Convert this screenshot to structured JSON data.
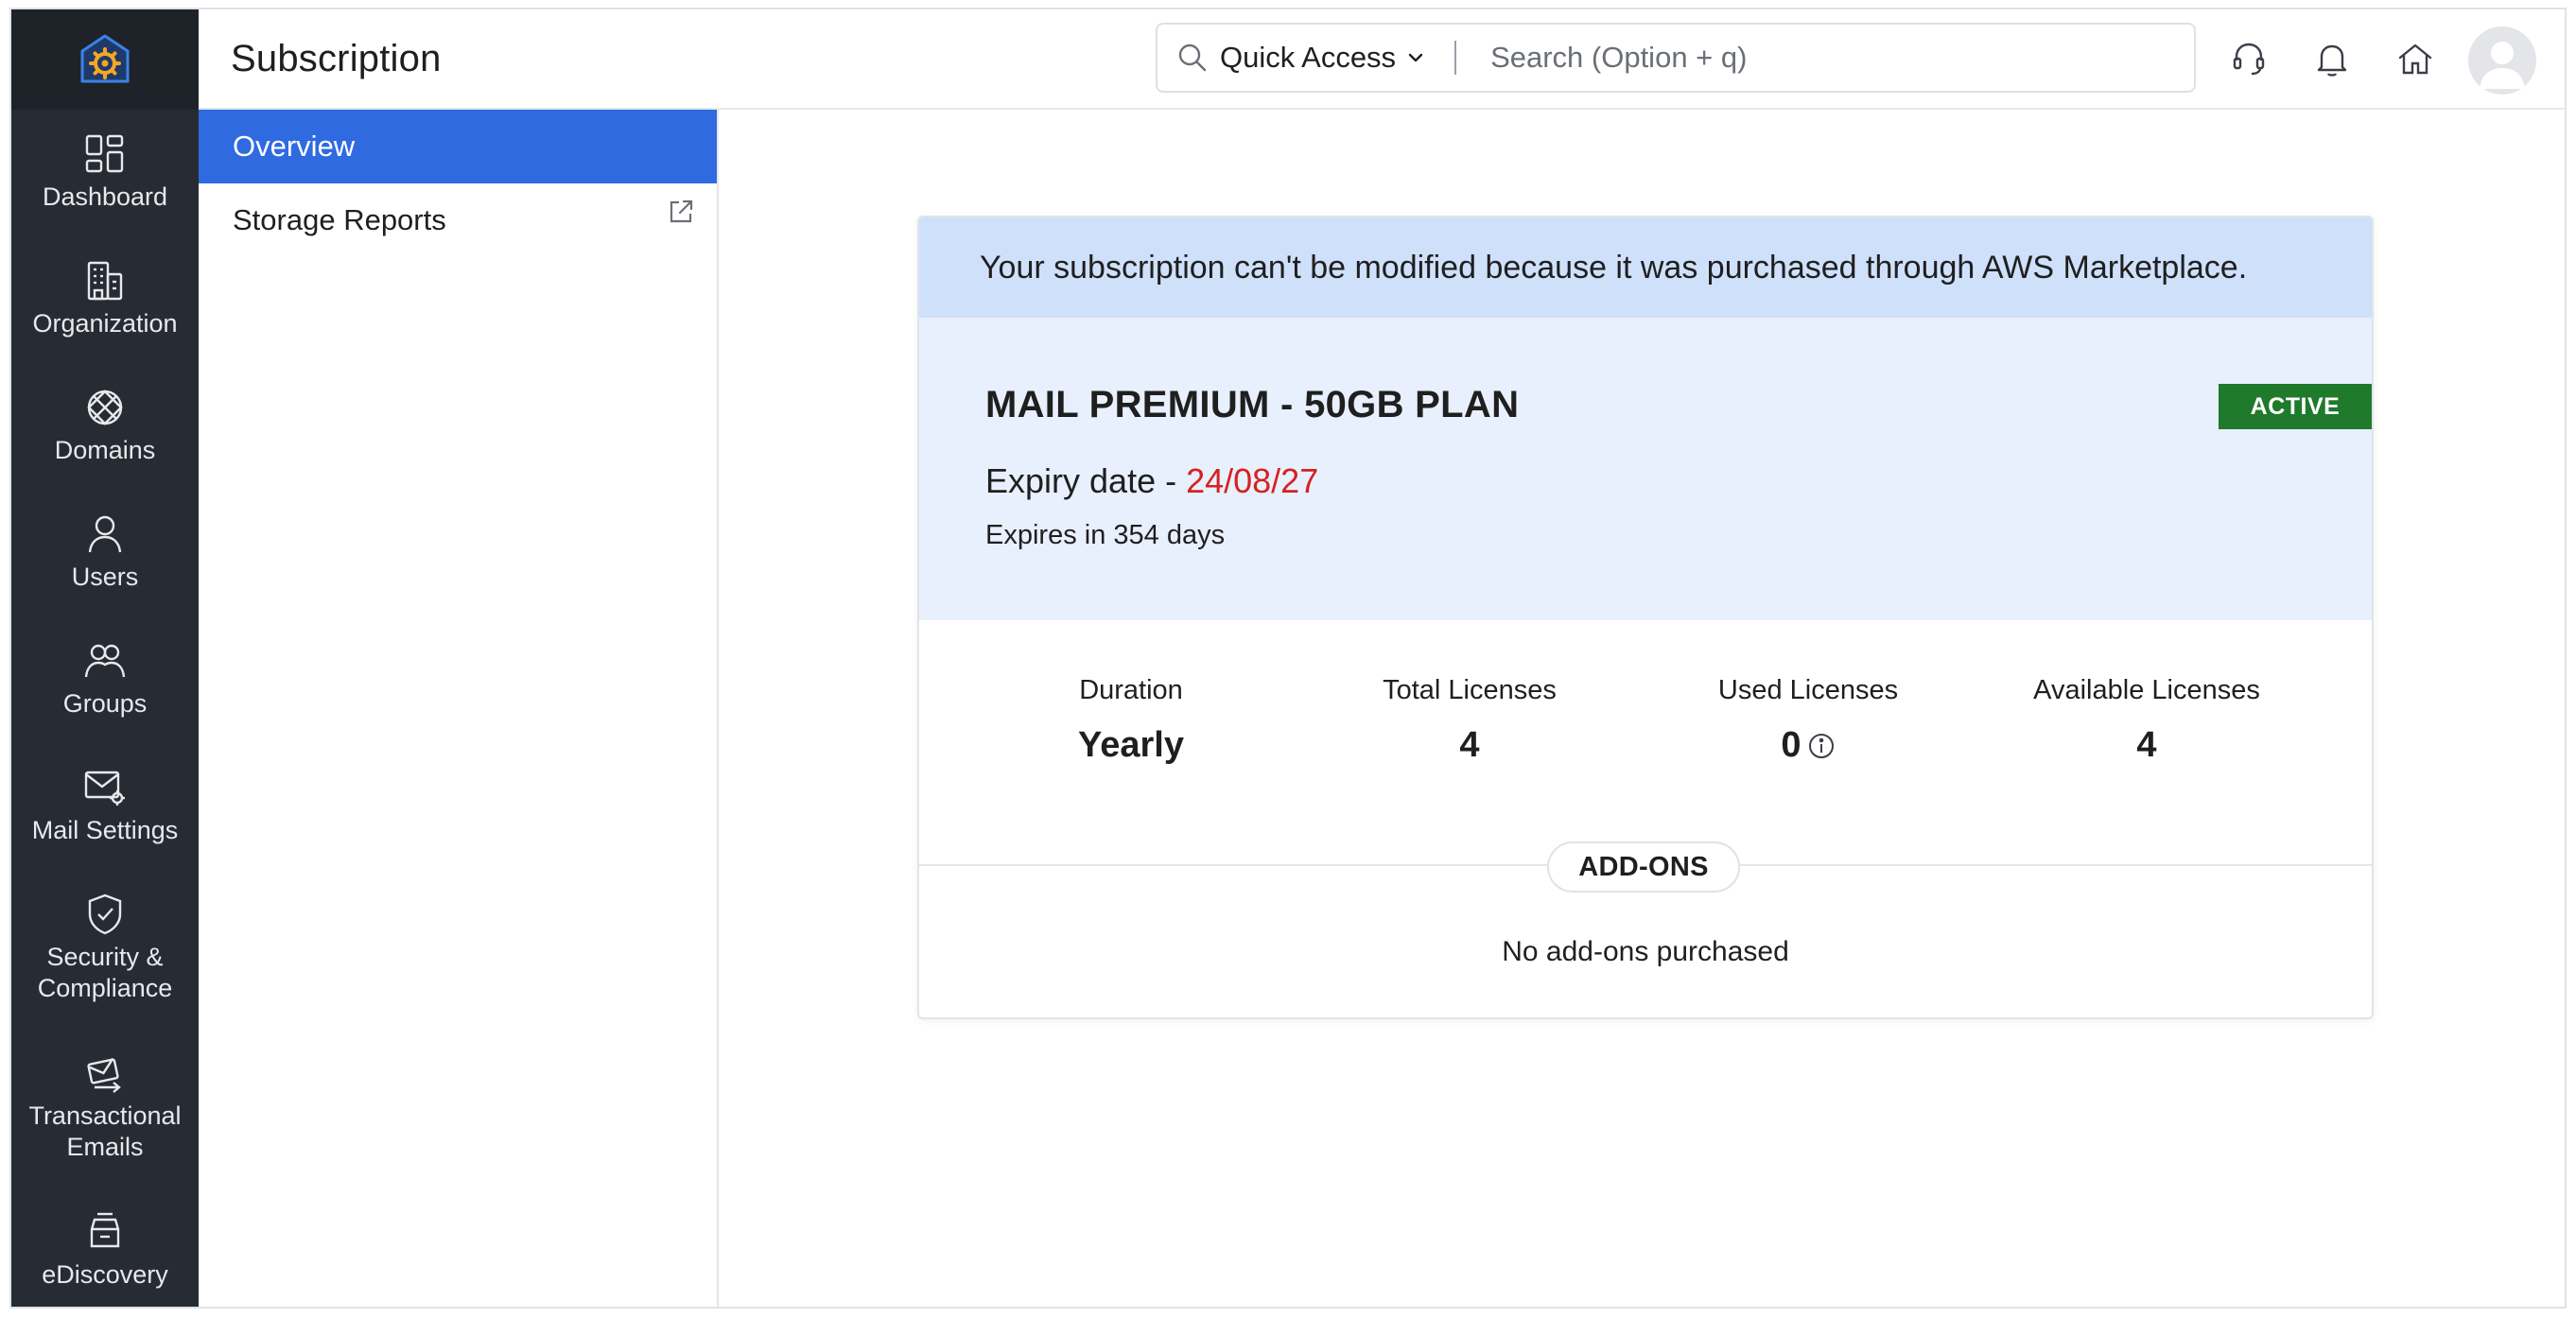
{
  "header": {
    "title": "Subscription",
    "quick_access": "Quick Access",
    "search_placeholder": "Search (Option + q)"
  },
  "rail": {
    "items": [
      {
        "label": "Dashboard",
        "icon": "dashboard-icon"
      },
      {
        "label": "Organization",
        "icon": "organization-icon"
      },
      {
        "label": "Domains",
        "icon": "domains-icon"
      },
      {
        "label": "Users",
        "icon": "user-icon"
      },
      {
        "label": "Groups",
        "icon": "groups-icon"
      },
      {
        "label": "Mail Settings",
        "icon": "mail-settings-icon"
      },
      {
        "label": "Security &",
        "label2": "Compliance",
        "icon": "shield-check-icon"
      },
      {
        "label": "Transactional",
        "label2": "Emails",
        "icon": "transactional-email-icon"
      },
      {
        "label": "eDiscovery",
        "icon": "ediscovery-icon"
      }
    ]
  },
  "subnav": {
    "items": [
      {
        "label": "Overview",
        "active": true
      },
      {
        "label": "Storage Reports",
        "active": false
      }
    ]
  },
  "card": {
    "notice": "Your subscription can't be modified because it was purchased through AWS Marketplace.",
    "plan_name": "MAIL PREMIUM - 50GB PLAN",
    "status": "ACTIVE",
    "expiry_label": "Expiry date - ",
    "expiry_date": "24/08/27",
    "expires_in": "Expires in 354 days",
    "stats": [
      {
        "label": "Duration",
        "value": "Yearly"
      },
      {
        "label": "Total Licenses",
        "value": "4"
      },
      {
        "label": "Used Licenses",
        "value": "0"
      },
      {
        "label": "Available Licenses",
        "value": "4"
      }
    ],
    "addons_title": "ADD-ONS",
    "addons_empty": "No add-ons purchased"
  },
  "colors": {
    "rail_bg": "#272b33",
    "active_nav": "#2f6ae1",
    "notice_bg": "#cfe0fb",
    "plan_bg": "#e8f0fd",
    "active_badge": "#1f7a2b",
    "expiry_date": "#d52121",
    "logo_accent": "#f5a623"
  }
}
